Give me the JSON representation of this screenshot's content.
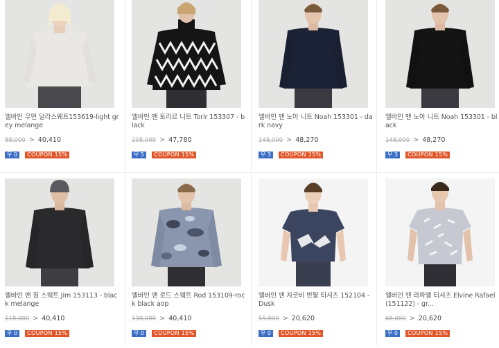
{
  "products": [
    {
      "title": "엘바인 우먼 달라스웨트153619-light grey melange",
      "original_price": "88,000",
      "price": "40,410",
      "badge": "무 0",
      "coupon": "COUPON 15%"
    },
    {
      "title": "엘바인 맨 토리르 니트 Torir 153307 - black",
      "original_price": "208,000",
      "price": "47,780",
      "badge": "무 5",
      "coupon": "COUPON 15%"
    },
    {
      "title": "엘바인 맨 노아 니트 Noah 153301 - dark navy",
      "original_price": "148,000",
      "price": "48,270",
      "badge": "무 3",
      "coupon": "COUPON 15%"
    },
    {
      "title": "엘바인 맨 노아 니트 Noah 153301 - black",
      "original_price": "148,000",
      "price": "48,270",
      "badge": "무 3",
      "coupon": "COUPON 15%"
    },
    {
      "title": "엘바인 맨 짐 스웨트 Jim 153113 - black melange",
      "original_price": "118,000",
      "price": "40,410",
      "badge": "무 0",
      "coupon": "COUPON 15%"
    },
    {
      "title": "엘바인 맨 로드 스웨트 Rod 153109-rock black aop",
      "original_price": "138,000",
      "price": "40,410",
      "badge": "무 0",
      "coupon": "COUPON 15%"
    },
    {
      "title": "엘바인 맨 자코비 반팔 티셔츠 152104 - Dusk",
      "original_price": "55,000",
      "price": "20,620",
      "badge": "무 0",
      "coupon": "COUPON 15%"
    },
    {
      "title": "엘바인 맨 라파엘 티셔츠 Elvine Rafael(151122) - gr...",
      "original_price": "68,000",
      "price": "20,620",
      "badge": "무 0",
      "coupon": "COUPON 15%"
    }
  ],
  "arrow": ">"
}
